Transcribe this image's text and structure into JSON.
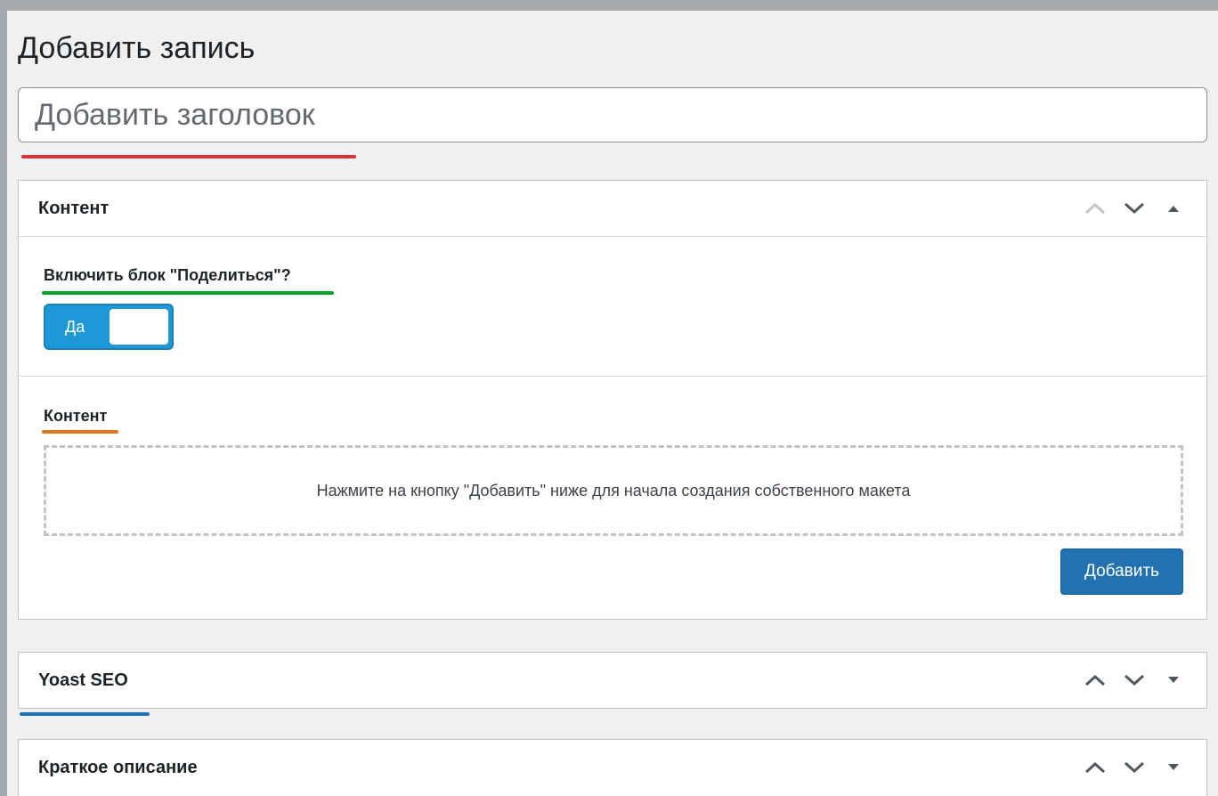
{
  "page": {
    "title": "Добавить запись",
    "title_placeholder": "Добавить заголовок"
  },
  "content_box": {
    "title": "Контент",
    "share_label": "Включить блок \"Поделиться\"?",
    "switch_label": "Да",
    "switch_on": true,
    "content_label": "Контент",
    "empty_message": "Нажмите на кнопку \"Добавить\" ниже для начала создания собственного макета",
    "add_button": "Добавить"
  },
  "yoast_box": {
    "title": "Yoast SEO"
  },
  "excerpt_box": {
    "title": "Краткое описание"
  },
  "colors": {
    "red_underline": "#d63638",
    "green_underline": "#00a32a",
    "orange_underline": "#e6761b",
    "blue_underline": "#2271b1",
    "switch_bg": "#1e98d6",
    "button_bg": "#2271b1"
  },
  "icons": {
    "move_up": "chevron-up-icon",
    "move_down": "chevron-down-icon",
    "collapse": "triangle-up-icon",
    "expand": "triangle-down-icon"
  }
}
